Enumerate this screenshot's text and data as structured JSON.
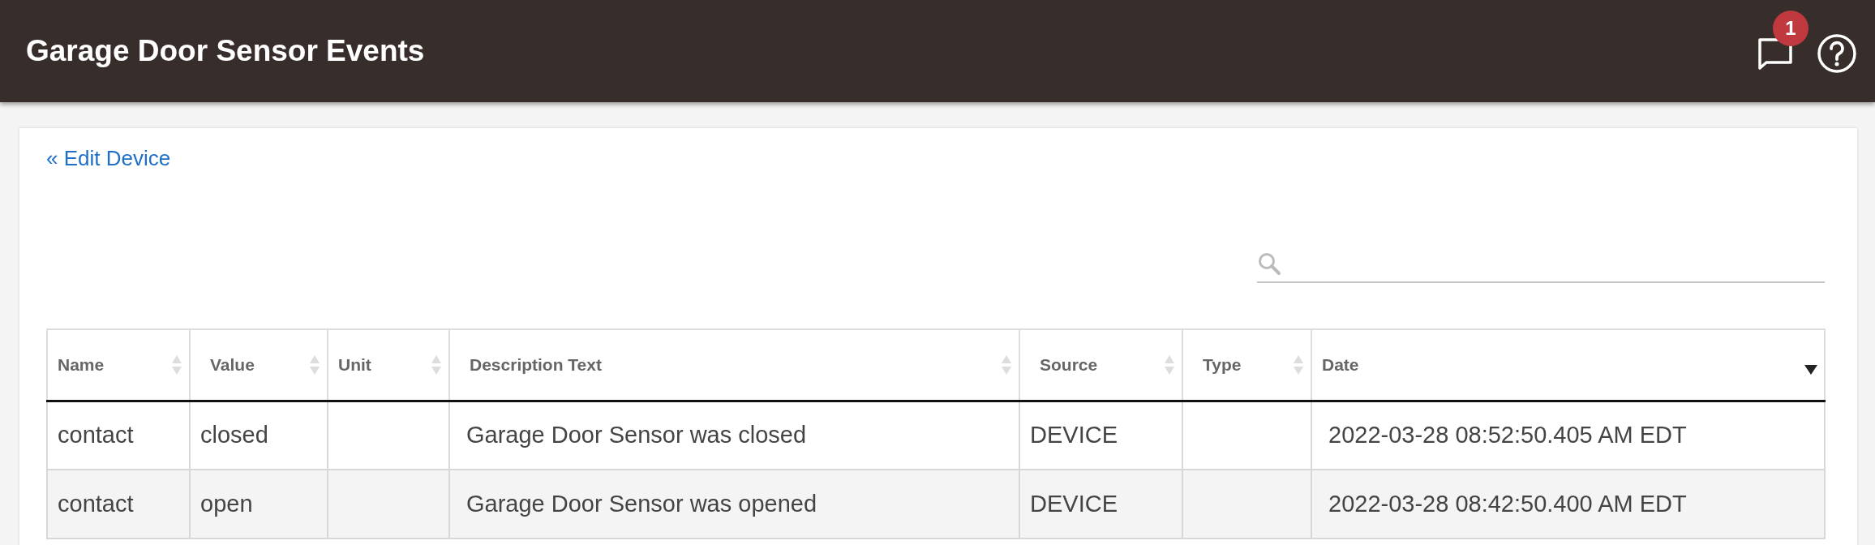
{
  "header": {
    "title": "Garage Door Sensor Events",
    "notification_count": "1"
  },
  "back_link": "« Edit Device",
  "table": {
    "columns": [
      {
        "label": "Name",
        "sorted": false
      },
      {
        "label": "Value",
        "sorted": false
      },
      {
        "label": "Unit",
        "sorted": false
      },
      {
        "label": "Description Text",
        "sorted": false
      },
      {
        "label": "Source",
        "sorted": false
      },
      {
        "label": "Type",
        "sorted": false
      },
      {
        "label": "Date",
        "sorted": true
      }
    ],
    "rows": [
      [
        "contact",
        "closed",
        "",
        "Garage Door Sensor was closed",
        "DEVICE",
        "",
        "2022-03-28 08:52:50.405 AM EDT"
      ],
      [
        "contact",
        "open",
        "",
        "Garage Door Sensor was opened",
        "DEVICE",
        "",
        "2022-03-28 08:42:50.400 AM EDT"
      ]
    ]
  }
}
